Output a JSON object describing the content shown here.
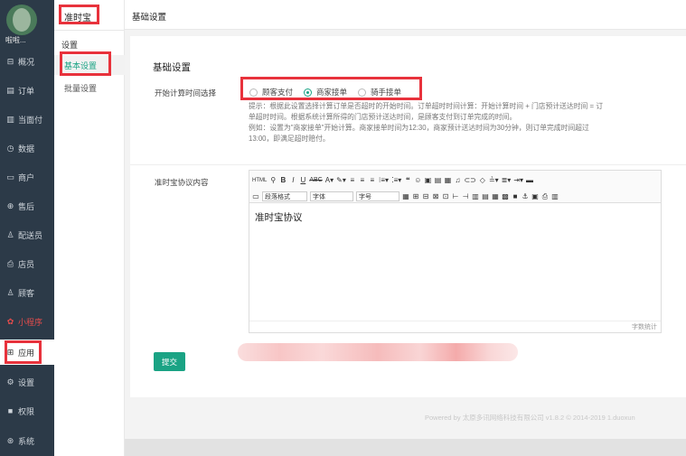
{
  "sidebar": {
    "username": "啦啦...",
    "items": [
      {
        "label": "概况",
        "icon": "overview-icon",
        "glyph": "⊟"
      },
      {
        "label": "订单",
        "icon": "order-icon",
        "glyph": "▤"
      },
      {
        "label": "当面付",
        "icon": "pay-icon",
        "glyph": "▥"
      },
      {
        "label": "数据",
        "icon": "data-icon",
        "glyph": "◷"
      },
      {
        "label": "商户",
        "icon": "merchant-icon",
        "glyph": "▭"
      },
      {
        "label": "售后",
        "icon": "aftersale-icon",
        "glyph": "⊕"
      },
      {
        "label": "配送员",
        "icon": "courier-icon",
        "glyph": "♙"
      },
      {
        "label": "店员",
        "icon": "clerk-icon",
        "glyph": "⎙"
      },
      {
        "label": "顾客",
        "icon": "customer-icon",
        "glyph": "♙"
      },
      {
        "label": "小程序",
        "icon": "miniprogram-icon",
        "glyph": "✿"
      },
      {
        "label": "应用",
        "icon": "apps-icon",
        "glyph": "⊞"
      },
      {
        "label": "设置",
        "icon": "settings-icon",
        "glyph": "⚙"
      },
      {
        "label": "权限",
        "icon": "lock-icon",
        "glyph": "🔒"
      },
      {
        "label": "系统",
        "icon": "system-icon",
        "glyph": "⊛"
      }
    ]
  },
  "subnav": {
    "title": "准时宝",
    "group": "设置",
    "items": [
      "基本设置",
      "批量设置"
    ]
  },
  "header": {
    "title": "基础设置"
  },
  "form": {
    "section_title": "基础设置",
    "start_label": "开始计算时间选择",
    "options": [
      "顾客支付",
      "商家接单",
      "骑手接单"
    ],
    "selected": "商家接单",
    "help_line1": "提示：根据此设置选择计算订单是否超时的开始时间。订单超时时间计算：开始计算时间 + 门店预计送达时间 = 订",
    "help_line2": "单超时时间。根据系统计算所得的门店预计送达时间，是顾客支付到订单完成的时间。",
    "help_line3": "例如：设置为\"商家接单\"开始计算。商家接单时间为12:30，商家预计送达时间为30分钟，则订单完成时间超过",
    "help_line4": "13:00，即满足超时赔付。",
    "agreement_label": "准时宝协议内容",
    "editor_content": "准时宝协议",
    "word_count": "字数统计",
    "submit": "提交",
    "toolbar": {
      "html": "HTML",
      "paragraph": "段落格式",
      "font": "字体",
      "size": "字号"
    }
  },
  "footer": {
    "copyright": "Powered by 太原多讯网络科技有限公司 v1.8.2 © 2014-2019 1.duoxun"
  }
}
